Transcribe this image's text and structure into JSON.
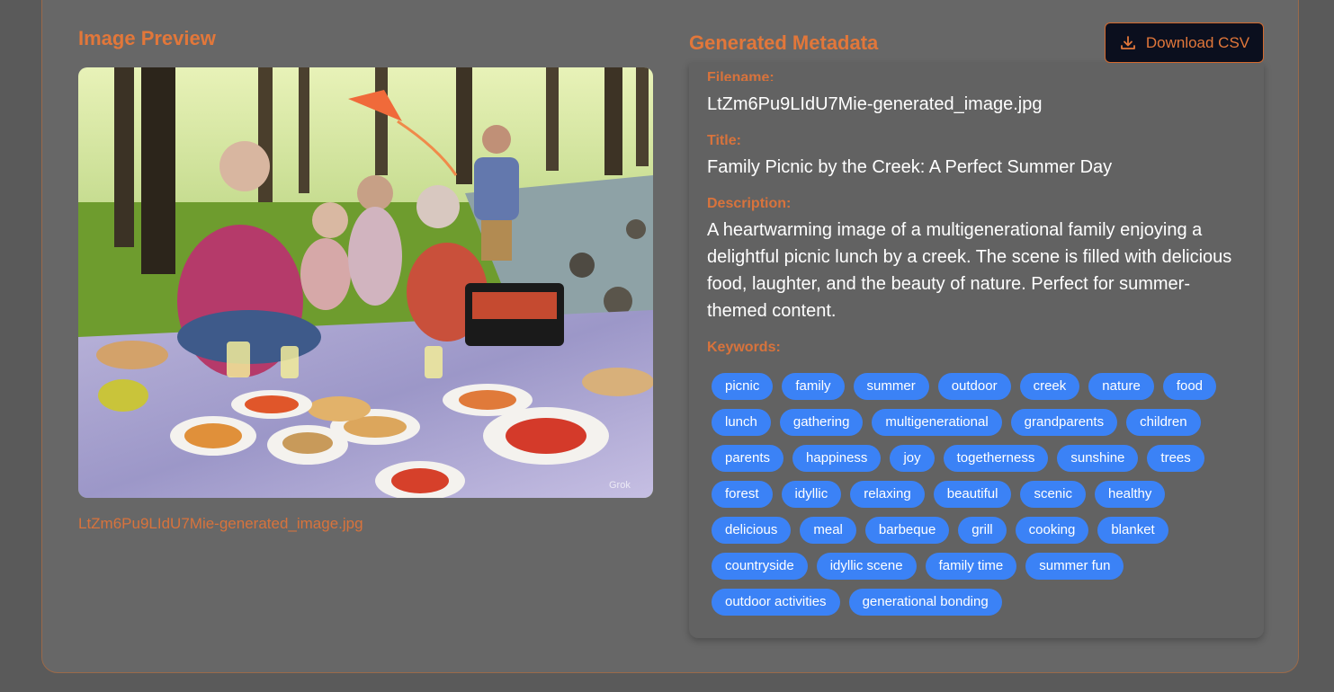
{
  "left": {
    "title": "Image Preview",
    "caption": "LtZm6Pu9LIdU7Mie-generated_image.jpg",
    "watermark": "Grok"
  },
  "right": {
    "title": "Generated Metadata",
    "download_label": "Download CSV",
    "filename_label": "Filename:",
    "filename": "LtZm6Pu9LIdU7Mie-generated_image.jpg",
    "title_label": "Title:",
    "title_value": "Family Picnic by the Creek: A Perfect Summer Day",
    "description_label": "Description:",
    "description_lines": [
      "A heartwarming image of a multigenerational family enjoying a",
      "delightful picnic lunch by a creek. The scene is filled with delicious",
      "food, laughter, and the beauty of nature. Perfect for summer-",
      "themed content."
    ],
    "keywords_label": "Keywords:",
    "keywords": [
      "picnic",
      "family",
      "summer",
      "outdoor",
      "creek",
      "nature",
      "food",
      "lunch",
      "gathering",
      "multigenerational",
      "grandparents",
      "children",
      "parents",
      "happiness",
      "joy",
      "togetherness",
      "sunshine",
      "trees",
      "forest",
      "idyllic",
      "relaxing",
      "beautiful",
      "scenic",
      "healthy",
      "delicious",
      "meal",
      "barbeque",
      "grill",
      "cooking",
      "blanket",
      "countryside",
      "idyllic scene",
      "family time",
      "summer fun",
      "outdoor activities",
      "generational bonding"
    ]
  },
  "colors": {
    "accent": "#e2773a",
    "tag": "#3b82f6",
    "button_bg": "#0b0f1e"
  }
}
